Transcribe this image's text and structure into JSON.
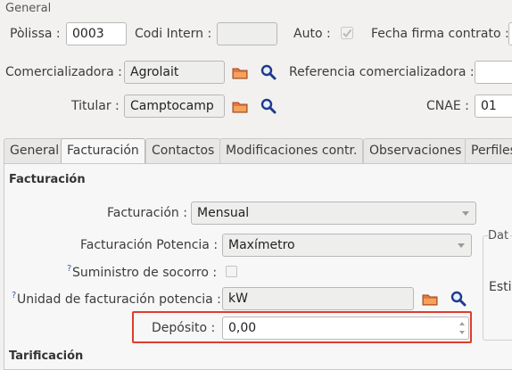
{
  "general": {
    "group_label": "General",
    "polissa_label": "Pòlissa :",
    "polissa_value": "0003",
    "codi_intern_label": "Codi Intern :",
    "codi_intern_value": "",
    "auto_label": "Auto :",
    "fecha_firma_label": "Fecha firma contrato :",
    "comercializadora_label": "Comercializadora :",
    "comercializadora_value": "Agrolait",
    "referencia_label": "Referencia comercializadora :",
    "titular_label": "Titular :",
    "titular_value": "Camptocamp",
    "cnae_label": "CNAE :",
    "cnae_value": "01"
  },
  "tabs": [
    {
      "label": "General"
    },
    {
      "label": "Facturación"
    },
    {
      "label": "Contactos"
    },
    {
      "label": "Modificaciones contr."
    },
    {
      "label": "Observaciones"
    },
    {
      "label": "Perfiles"
    }
  ],
  "active_tab": "Facturación",
  "facturacion": {
    "section_title": "Facturación",
    "facturacion_label": "Facturación :",
    "facturacion_value": "Mensual",
    "potencia_label": "Facturación Potencia :",
    "potencia_value": "Maxímetro",
    "socorro_help": "?",
    "socorro_label": "Suministro de socorro :",
    "unidad_help": "?",
    "unidad_label": "Unidad de facturación potencia :",
    "unidad_value": "kW",
    "deposito_label": "Depósito :",
    "deposito_value": "0,00",
    "right_group_label": "Dat",
    "right_est_label": "Esti",
    "next_section_title": "Tarificación"
  },
  "colors": {
    "highlight": "#e03c2e",
    "folder_icon": "#e8763a",
    "search_icon": "#1f3a8c"
  }
}
